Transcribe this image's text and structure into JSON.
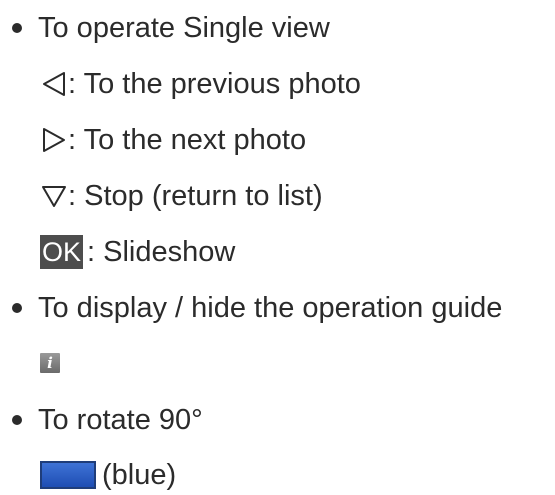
{
  "sections": [
    {
      "heading": "To operate Single view",
      "items": [
        {
          "icon": "left-triangle-icon",
          "text": ": To the previous photo"
        },
        {
          "icon": "right-triangle-icon",
          "text": ": To the next photo"
        },
        {
          "icon": "down-triangle-icon",
          "text": ": Stop (return to list)"
        },
        {
          "key": "OK",
          "text": ": Slideshow"
        }
      ]
    },
    {
      "heading": "To display / hide the operation guide",
      "icon": "info-icon",
      "icon_glyph": "i"
    },
    {
      "heading": "To rotate 90°",
      "icon": "blue-button-icon",
      "text": "(blue)",
      "color": "#2a5ccc"
    }
  ]
}
